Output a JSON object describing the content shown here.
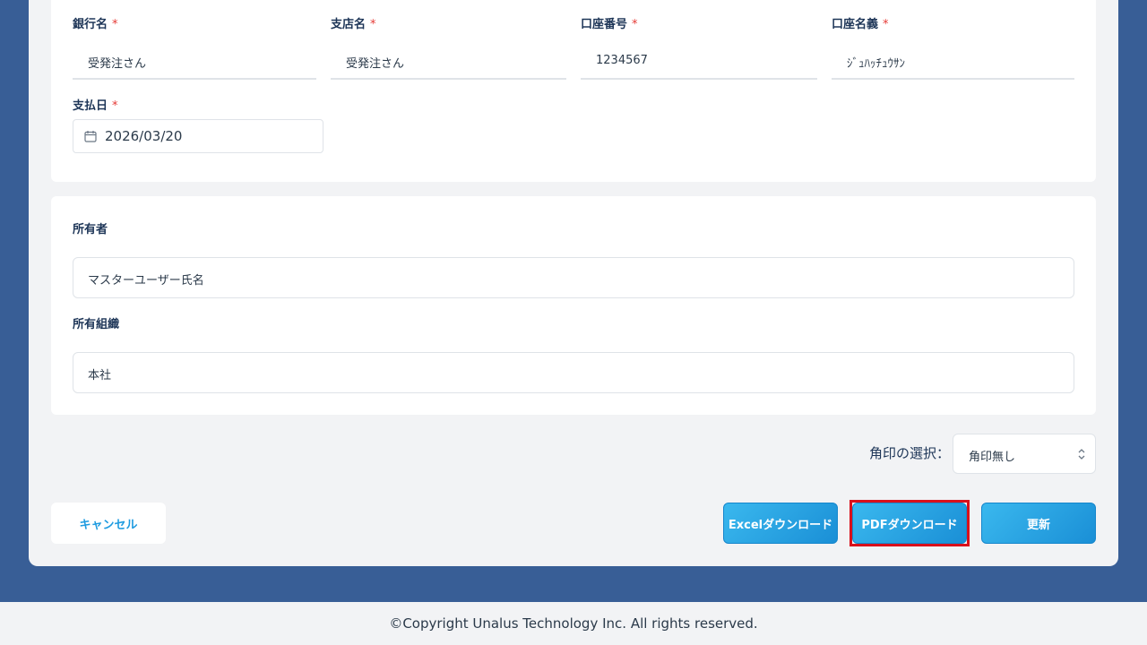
{
  "bank": {
    "bank_name_label": "銀行名",
    "bank_name_value": "受発注さん",
    "branch_name_label": "支店名",
    "branch_name_value": "受発注さん",
    "account_number_label": "口座番号",
    "account_number_value": "1234567",
    "account_holder_label": "口座名義",
    "account_holder_value": "ｼﾞｭﾊｯﾁｭｳｻﾝ",
    "payment_date_label": "支払日",
    "payment_date_value": "2026/03/20",
    "required_mark": "*"
  },
  "ownership": {
    "owner_label": "所有者",
    "owner_value": "マスターユーザー氏名",
    "org_label": "所有組織",
    "org_value": "本社"
  },
  "seal": {
    "label": "角印の選択：",
    "selected": "角印無し"
  },
  "actions": {
    "cancel": "キャンセル",
    "excel": "Excelダウンロード",
    "pdf": "PDFダウンロード",
    "update": "更新"
  },
  "footer": {
    "copyright": "©Copyright Unalus Technology Inc. All rights reserved."
  },
  "colors": {
    "background": "#385e96",
    "panel": "#f2f3f5",
    "accent": "#1e9be0",
    "required": "#e53935",
    "highlight": "#d9101c"
  }
}
